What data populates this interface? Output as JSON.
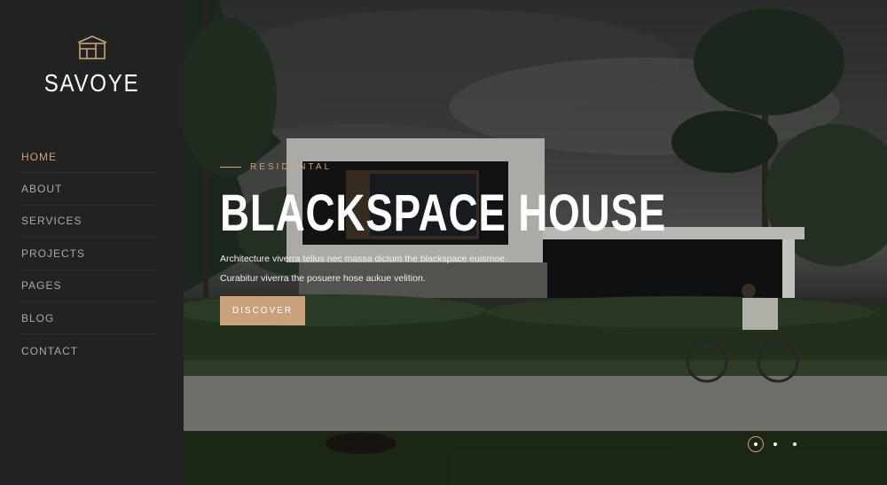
{
  "brand": {
    "name": "SAVOYE",
    "icon": "building-logo-icon",
    "accent": "#c9a27b"
  },
  "nav": {
    "items": [
      {
        "label": "HOME",
        "active": true
      },
      {
        "label": "ABOUT"
      },
      {
        "label": "SERVICES"
      },
      {
        "label": "PROJECTS"
      },
      {
        "label": "PAGES"
      },
      {
        "label": "BLOG"
      },
      {
        "label": "CONTACT"
      }
    ]
  },
  "hero": {
    "subtitle": "RESIDENTAL",
    "title": "BLACKSPACE HOUSE",
    "description_line1": "Architecture viverra tellus nec massa dictum the blackspace euismoe.",
    "description_line2": "Curabitur viverra the posuere hose aukue velition.",
    "button_label": "DISCOVER",
    "slides": {
      "count": 3,
      "active": 1
    }
  }
}
